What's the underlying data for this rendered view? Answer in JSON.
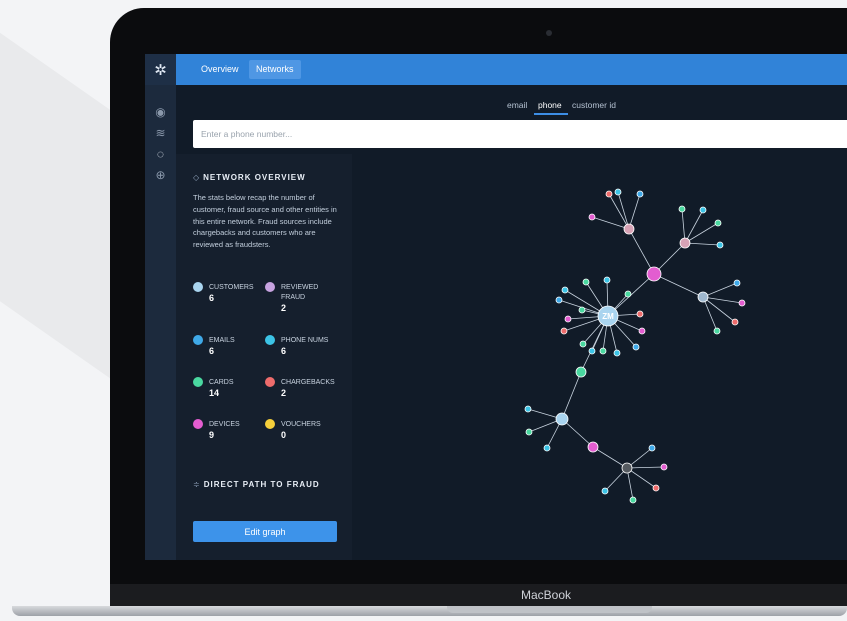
{
  "nav": {
    "tabs": [
      {
        "label": "Overview"
      },
      {
        "label": "Networks"
      }
    ]
  },
  "search": {
    "tabs": [
      {
        "label": "email"
      },
      {
        "label": "phone"
      },
      {
        "label": "customer id"
      }
    ],
    "active_tab": "phone",
    "placeholder": "Enter a phone number..."
  },
  "overview": {
    "title": "NETWORK OVERVIEW",
    "description": "The stats below recap the number of customer, fraud source and other entities in this entire network. Fraud sources include chargebacks and customers who are reviewed as fraudsters.",
    "stats": [
      {
        "label": "CUSTOMERS",
        "value": "6",
        "color": "#a9d4ef",
        "icon": "user-icon"
      },
      {
        "label": "REVIEWED FRAUD",
        "value": "2",
        "color": "#c7a3e0",
        "icon": "flag-icon"
      },
      {
        "label": "EMAILS",
        "value": "6",
        "color": "#3fa9e8",
        "icon": "mail-icon"
      },
      {
        "label": "PHONE NUMS",
        "value": "6",
        "color": "#3cc4e6",
        "icon": "phone-icon"
      },
      {
        "label": "CARDS",
        "value": "14",
        "color": "#4ad8a0",
        "icon": "card-icon"
      },
      {
        "label": "CHARGEBACKS",
        "value": "2",
        "color": "#ee6c6c",
        "icon": "chargeback-icon"
      },
      {
        "label": "DEVICES",
        "value": "9",
        "color": "#e35dd0",
        "icon": "device-icon"
      },
      {
        "label": "VOUCHERS",
        "value": "0",
        "color": "#f5cf3b",
        "icon": "voucher-icon"
      }
    ]
  },
  "path": {
    "title": "DIRECT PATH TO FRAUD"
  },
  "actions": {
    "edit_label": "Edit graph"
  },
  "graph": {
    "center_label": "ZM"
  },
  "device": {
    "brand": "MacBook"
  }
}
